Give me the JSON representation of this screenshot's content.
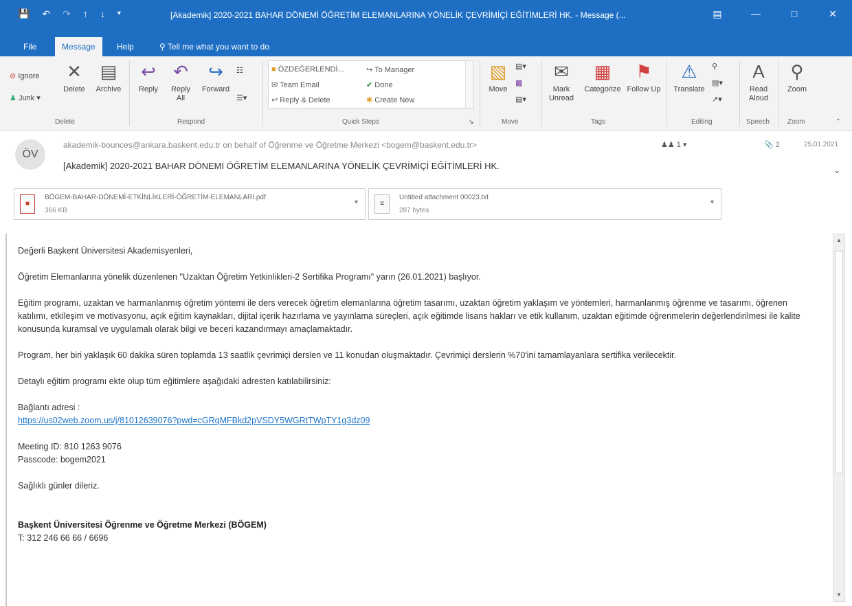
{
  "window": {
    "title": "[Akademik] 2020-2021 BAHAR DÖNEMİ ÖĞRETİM ELEMANLARINA YÖNELİK ÇEVRİMİÇİ EĞİTİMLERİ HK. - Message (...",
    "brand_color": "#1e6fc4"
  },
  "tabs": [
    {
      "label": "File"
    },
    {
      "label": "Message"
    },
    {
      "label": "Help"
    },
    {
      "label": "Tell me what you want to do"
    }
  ],
  "ribbon": {
    "delete_group": {
      "ignore": "Ignore",
      "junk": "Junk",
      "delete": "Delete",
      "archive": "Archive",
      "label": "Delete"
    },
    "respond_group": {
      "reply": "Reply",
      "reply_all": "Reply All",
      "forward": "Forward",
      "label": "Respond"
    },
    "quick_steps": {
      "items": [
        "ÖZDEĞERLENDİ...",
        "To Manager",
        "Team Email",
        "Done",
        "Reply & Delete",
        "Create New"
      ],
      "label": "Quick Steps"
    },
    "move_group": {
      "move": "Move",
      "label": "Move"
    },
    "tags_group": {
      "mark_unread": "Mark Unread",
      "categorize": "Categorize",
      "follow_up": "Follow Up",
      "label": "Tags"
    },
    "editing_group": {
      "translate": "Translate",
      "label": "Editing"
    },
    "speech_group": {
      "read_aloud": "Read Aloud",
      "label": "Speech"
    },
    "zoom_group": {
      "zoom": "Zoom",
      "label": "Zoom"
    }
  },
  "message": {
    "avatar_initials": "ÖV",
    "from": "akademik-bounces@ankara.baskent.edu.tr on behalf of Öğrenme ve Öğretme Merkezi <bogem@baskent.edu.tr>",
    "recipients": "1",
    "attachment_count": "2",
    "date": "25.01.2021",
    "subject": "[Akademik] 2020-2021 BAHAR DÖNEMİ ÖĞRETİM ELEMANLARINA YÖNELİK ÇEVRİMİÇİ EĞİTİMLERİ HK."
  },
  "attachments": [
    {
      "name": "BÖGEM-BAHAR-DÖNEMİ-ETKİNLİKLERİ-ÖĞRETİM-ELEMANLARI.pdf",
      "size": "366 KB",
      "icon": "pdf-icon"
    },
    {
      "name": "Untitled attachment 00023.txt",
      "size": "287 bytes",
      "icon": "text-file-icon"
    }
  ],
  "body": {
    "greeting": "Değerli Başkent Üniversitesi Akademisyenleri,",
    "p1": "Öğretim Elemanlarına yönelik düzenlenen \"Uzaktan Öğretim Yetkinlikleri-2 Sertifika Programı\" yarın (26.01.2021) başlıyor.",
    "p2": "Eğitim programı, uzaktan ve harmanlanmış öğretim yöntemi ile ders verecek öğretim elemanlarına öğretim tasarımı, uzaktan öğretim yaklaşım ve yöntemleri, harmanlanmış öğrenme ve tasarımı, öğrenen katılımı, etkileşim ve motivasyonu, açık eğitim kaynakları, dijital içerik hazırlama ve yayınlama süreçleri, açık eğitimde lisans hakları ve etik kullanım, uzaktan eğitimde öğrenmelerin değerlendirilmesi ile kalite konusunda kuramsal ve uygulamalı olarak bilgi ve beceri kazandırmayı amaçlamaktadır.",
    "p3": "Program, her biri yaklaşık 60 dakika süren toplamda 13 saatlik çevrimiçi derslen ve 11 konudan oluşmaktadır. Çevrimiçi derslerin %70'ini tamamlayanlara sertifika verilecektir.",
    "p4": "Detaylı eğitim programı ekte olup tüm eğitimlere aşağıdaki adresten katılabilirsiniz:",
    "link_label": "Bağlantı adresi :",
    "link_url": "https://us02web.zoom.us/j/81012639076?pwd=cGRqMFBkd2pVSDY5WGRtTWpTY1g3dz09",
    "meeting_id": "Meeting ID: 810 1263 9076",
    "passcode": "Passcode: bogem2021",
    "closing": "Sağlıklı günler dileriz.",
    "sig_name": "Başkent Üniversitesi Öğrenme ve Öğretme Merkezi (BÖGEM)",
    "sig_phone": "T: 312 246 66 66 / 6696"
  }
}
